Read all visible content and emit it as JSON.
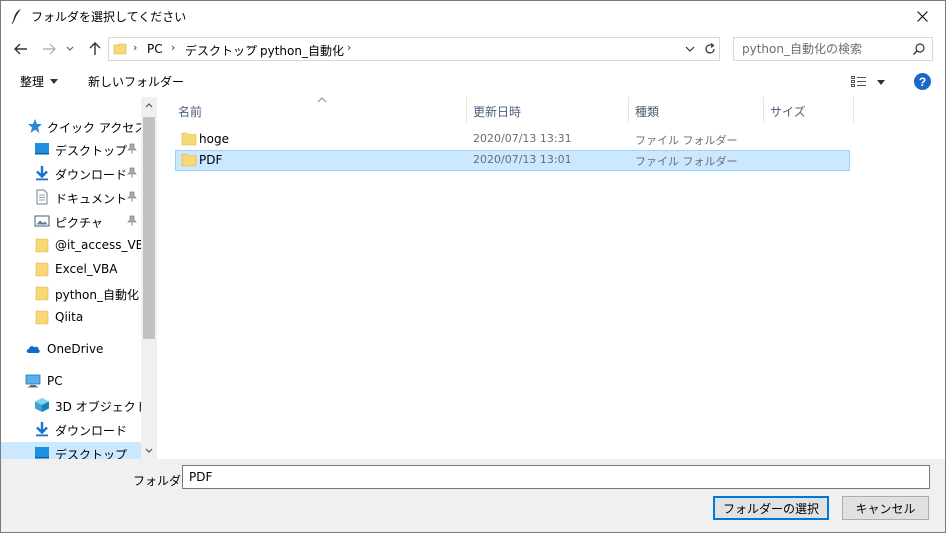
{
  "window": {
    "title": "フォルダを選択してください"
  },
  "nav": {
    "address_segments": [
      "PC",
      "デスクトップ",
      "python_自動化"
    ],
    "search_placeholder": "python_自動化の検索"
  },
  "toolbar": {
    "organize_label": "整理",
    "new_folder_label": "新しいフォルダー"
  },
  "sidebar": {
    "quick_access_label": "クイック アクセス",
    "quick_items": [
      {
        "label": "デスクトップ",
        "icon": "desktop-icon"
      },
      {
        "label": "ダウンロード",
        "icon": "download-icon"
      },
      {
        "label": "ドキュメント",
        "icon": "document-icon"
      },
      {
        "label": "ピクチャ",
        "icon": "pictures-icon"
      }
    ],
    "folders": [
      "@it_access_VBA",
      "Excel_VBA",
      "python_自動化",
      "Qiita"
    ],
    "onedrive_label": "OneDrive",
    "pc_label": "PC",
    "pc_items": [
      {
        "label": "3D オブジェクト",
        "icon": "3d-objects-icon"
      },
      {
        "label": "ダウンロード",
        "icon": "download-icon"
      },
      {
        "label": "デスクトップ",
        "icon": "desktop-icon"
      }
    ]
  },
  "columns": {
    "name": "名前",
    "date": "更新日時",
    "type": "種類",
    "size": "サイズ"
  },
  "files": [
    {
      "name": "hoge",
      "date": "2020/07/13 13:31",
      "type": "ファイル フォルダー",
      "selected": false
    },
    {
      "name": "PDF",
      "date": "2020/07/13 13:01",
      "type": "ファイル フォルダー",
      "selected": true
    }
  ],
  "bottom": {
    "folder_label": "フォルダー:",
    "folder_value": "PDF",
    "select_button": "フォルダーの選択",
    "cancel_button": "キャンセル"
  },
  "colors": {
    "accent": "#0078d7",
    "selection": "#cce8ff",
    "folder": "#f8d775",
    "help": "#1a69c4"
  }
}
